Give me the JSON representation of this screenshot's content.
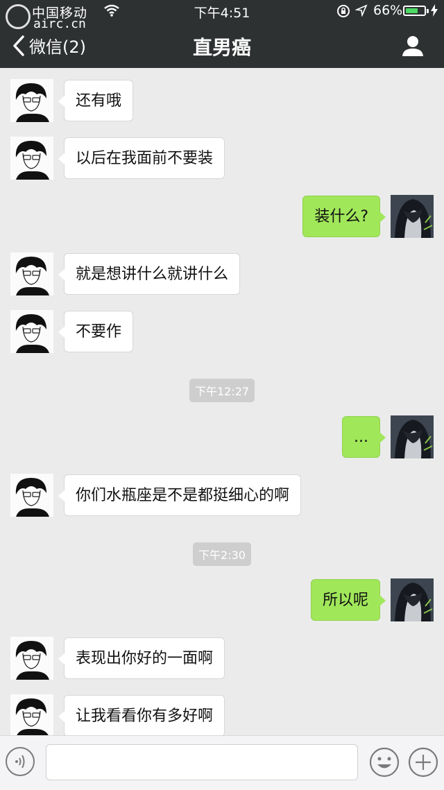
{
  "status_bar": {
    "carrier": "中国移动",
    "watermark_sub": "airc.cn",
    "time": "下午4:51",
    "battery_percent": "66%",
    "battery_level": 0.66
  },
  "header": {
    "back_label": "微信(2)",
    "title": "直男癌"
  },
  "messages": [
    {
      "side": "left",
      "text": "还有哦"
    },
    {
      "side": "left",
      "text": "以后在我面前不要装"
    },
    {
      "side": "right",
      "text": "装什么?"
    },
    {
      "side": "left",
      "text": "就是想讲什么就讲什么"
    },
    {
      "side": "left",
      "text": "不要作"
    },
    {
      "type": "timestamp",
      "text": "下午12:27"
    },
    {
      "side": "right",
      "text": "..."
    },
    {
      "side": "left",
      "text": "你们水瓶座是不是都挺细心的啊"
    },
    {
      "type": "timestamp",
      "text": "下午2:30"
    },
    {
      "side": "right",
      "text": "所以呢"
    },
    {
      "side": "left",
      "text": "表现出你好的一面啊"
    },
    {
      "side": "left",
      "text": "让我看看你有多好啊"
    }
  ],
  "colors": {
    "header_bg": "#2e3132",
    "chat_bg": "#ebebeb",
    "sent_bubble": "#a0e75a",
    "received_bubble": "#ffffff",
    "battery": "#4cd964"
  },
  "icons": {
    "back": "chevron-left-icon",
    "profile": "person-icon",
    "voice": "voice-icon",
    "emoji": "emoji-icon",
    "plus": "plus-icon"
  }
}
